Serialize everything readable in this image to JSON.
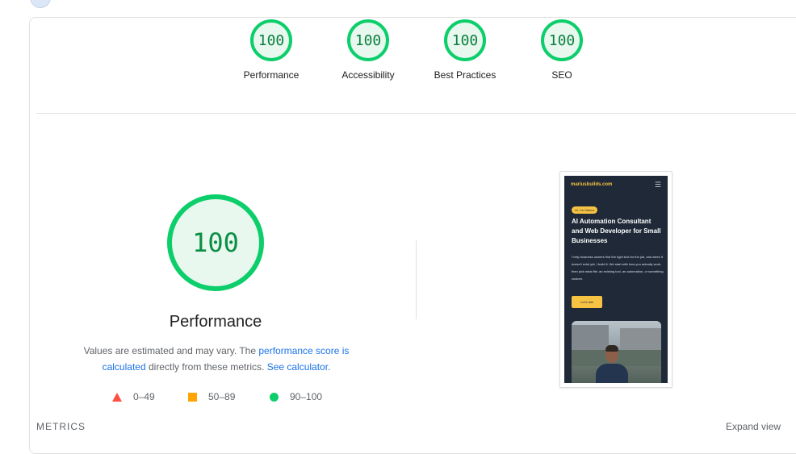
{
  "summary": {
    "gauges": [
      {
        "score": "100",
        "label": "Performance"
      },
      {
        "score": "100",
        "label": "Accessibility"
      },
      {
        "score": "100",
        "label": "Best Practices"
      },
      {
        "score": "100",
        "label": "SEO"
      }
    ]
  },
  "performance": {
    "score": "100",
    "title": "Performance",
    "desc_prefix": "Values are estimated and may vary. The ",
    "desc_link1": "performance score is calculated",
    "desc_middle": " directly from these metrics. ",
    "desc_link2": "See calculator.",
    "legend": [
      {
        "range": "0–49",
        "icon": "triangle-icon",
        "color": "#ff4e42"
      },
      {
        "range": "50–89",
        "icon": "square-icon",
        "color": "#ffa400"
      },
      {
        "range": "90–100",
        "icon": "circle-icon",
        "color": "#0cce6b"
      }
    ]
  },
  "screenshot": {
    "brand": "mariusbuilds.com",
    "badge": "Hi, I'm Marius",
    "heading": "AI Automation Consultant and Web Developer for Small Businesses",
    "body": "I help business owners find the right tool for the job, and when it doesn't exist yet, I build it. We start with how you actually work, then pick what fits: an existing tool, an automation, or something custom.",
    "cta": "Let's talk"
  },
  "footer": {
    "metrics_label": "METRICS",
    "expand_label": "Expand view"
  },
  "colors": {
    "pass": "#0cce6b",
    "average": "#ffa400",
    "fail": "#ff4e42",
    "link": "#1a73e8"
  }
}
